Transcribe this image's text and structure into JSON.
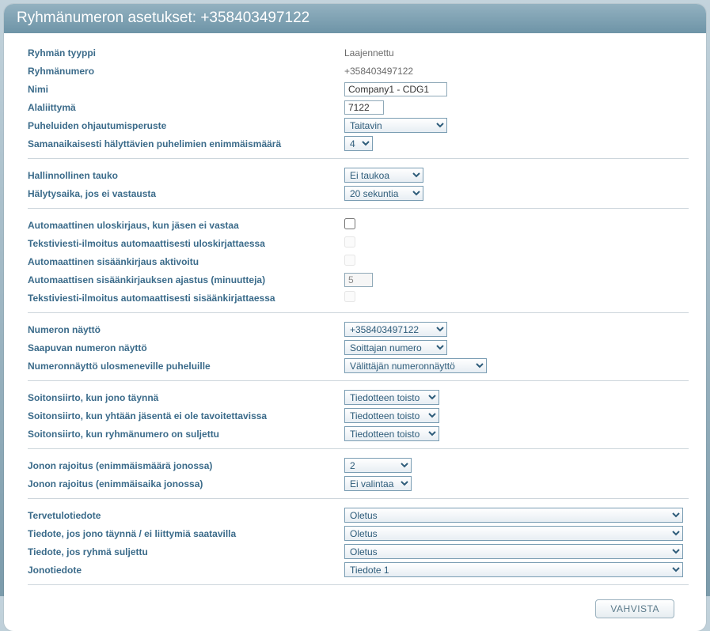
{
  "header": {
    "title": "Ryhmänumeron asetukset: +358403497122"
  },
  "section1": {
    "group_type_label": "Ryhmän tyyppi",
    "group_type_value": "Laajennettu",
    "group_number_label": "Ryhmänumero",
    "group_number_value": "+358403497122",
    "name_label": "Nimi",
    "name_value": "Company1 - CDG1",
    "extension_label": "Alaliittymä",
    "extension_value": "7122",
    "routing_label": "Puheluiden ohjautumisperuste",
    "routing_value": "Taitavin",
    "max_ring_label": "Samanaikaisesti hälyttävien puhelimien enimmäismäärä",
    "max_ring_value": "4"
  },
  "section2": {
    "admin_pause_label": "Hallinnollinen tauko",
    "admin_pause_value": "Ei taukoa",
    "alert_time_label": "Hälytysaika, jos ei vastausta",
    "alert_time_value": "20 sekuntia"
  },
  "section3": {
    "auto_logout_label": "Automaattinen uloskirjaus, kun jäsen ei vastaa",
    "sms_logout_label": "Tekstiviesti-ilmoitus automaattisesti uloskirjattaessa",
    "auto_login_label": "Automaattinen sisäänkirjaus aktivoitu",
    "auto_login_timer_label": "Automaattisen sisäänkirjauksen ajastus (minuutteja)",
    "auto_login_timer_value": "5",
    "sms_login_label": "Tekstiviesti-ilmoitus automaattisesti sisäänkirjattaessa"
  },
  "section4": {
    "num_display_label": "Numeron näyttö",
    "num_display_value": "+358403497122",
    "inc_num_display_label": "Saapuvan numeron näyttö",
    "inc_num_display_value": "Soittajan numero",
    "out_num_display_label": "Numeronnäyttö ulosmeneville puheluille",
    "out_num_display_value": "Välittäjän numeronnäyttö"
  },
  "section5": {
    "fwd_full_label": "Soitonsiirto, kun jono täynnä",
    "fwd_full_value": "Tiedotteen toisto",
    "fwd_none_label": "Soitonsiirto, kun yhtään jäsentä ei ole tavoitettavissa",
    "fwd_none_value": "Tiedotteen toisto",
    "fwd_closed_label": "Soitonsiirto, kun ryhmänumero on suljettu",
    "fwd_closed_value": "Tiedotteen toisto"
  },
  "section6": {
    "queue_max_count_label": "Jonon rajoitus (enimmäismäärä jonossa)",
    "queue_max_count_value": "2",
    "queue_max_time_label": "Jonon rajoitus (enimmäisaika jonossa)",
    "queue_max_time_value": "Ei valintaa"
  },
  "section7": {
    "welcome_label": "Tervetulotiedote",
    "welcome_value": "Oletus",
    "full_msg_label": "Tiedote, jos jono täynnä / ei liittymiä saatavilla",
    "full_msg_value": "Oletus",
    "closed_msg_label": "Tiedote, jos ryhmä suljettu",
    "closed_msg_value": "Oletus",
    "queue_msg_label": "Jonotiedote",
    "queue_msg_value": "Tiedote 1"
  },
  "footer": {
    "confirm_label": "VAHVISTA"
  }
}
